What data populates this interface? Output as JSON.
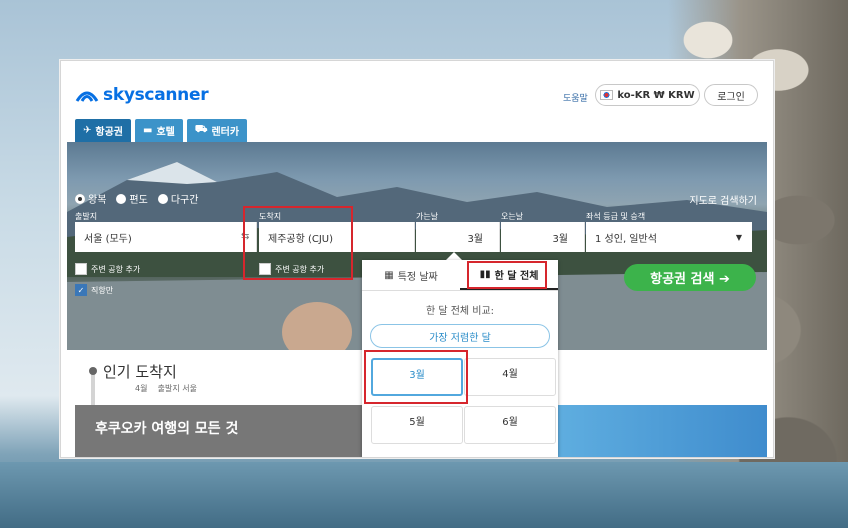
{
  "header": {
    "brand": "skyscanner",
    "help": "도움말",
    "locale": "ko-KR ₩ KRW",
    "login": "로그인"
  },
  "tabs": [
    {
      "label": "항공권",
      "icon": "plane-icon"
    },
    {
      "label": "호텔",
      "icon": "bed-icon"
    },
    {
      "label": "렌터카",
      "icon": "car-icon"
    }
  ],
  "trip_types": [
    {
      "label": "왕복",
      "selected": true
    },
    {
      "label": "편도",
      "selected": false
    },
    {
      "label": "다구간",
      "selected": false
    }
  ],
  "map_search": "지도로 검색하기",
  "form": {
    "origin_label": "출발지",
    "origin_value": "서울 (모두)",
    "destination_label": "도착지",
    "destination_value": "제주공항 (CJU)",
    "depart_label": "가는날",
    "depart_value": "3월",
    "return_label": "오는날",
    "return_value": "3월",
    "cabin_label": "좌석 등급 및 승객",
    "cabin_value": "1 성인, 일반석",
    "nearby_origin": "주변 공항 추가",
    "nearby_destination": "주변 공항 추가",
    "direct_only": "직항만",
    "search_button": "항공권 검색 ➔"
  },
  "calendar_popup": {
    "tab_specific": "특정 날짜",
    "tab_whole_month": "한 달 전체",
    "compare_title": "한 달 전체 비교:",
    "cheapest_month": "가장 저렴한 달",
    "months": [
      "3월",
      "4월",
      "5월",
      "6월"
    ],
    "selected_month": "3월"
  },
  "popular": {
    "title": "인기 도착지",
    "month": "4월",
    "origin_note": "출발지 서울",
    "banner_text": "후쿠오카 여행의 모든 것"
  },
  "colors": {
    "brand_blue": "#0770e3",
    "tab_blue": "#3c93c9",
    "search_green": "#3cb34b",
    "highlight_red": "#d6262d"
  }
}
